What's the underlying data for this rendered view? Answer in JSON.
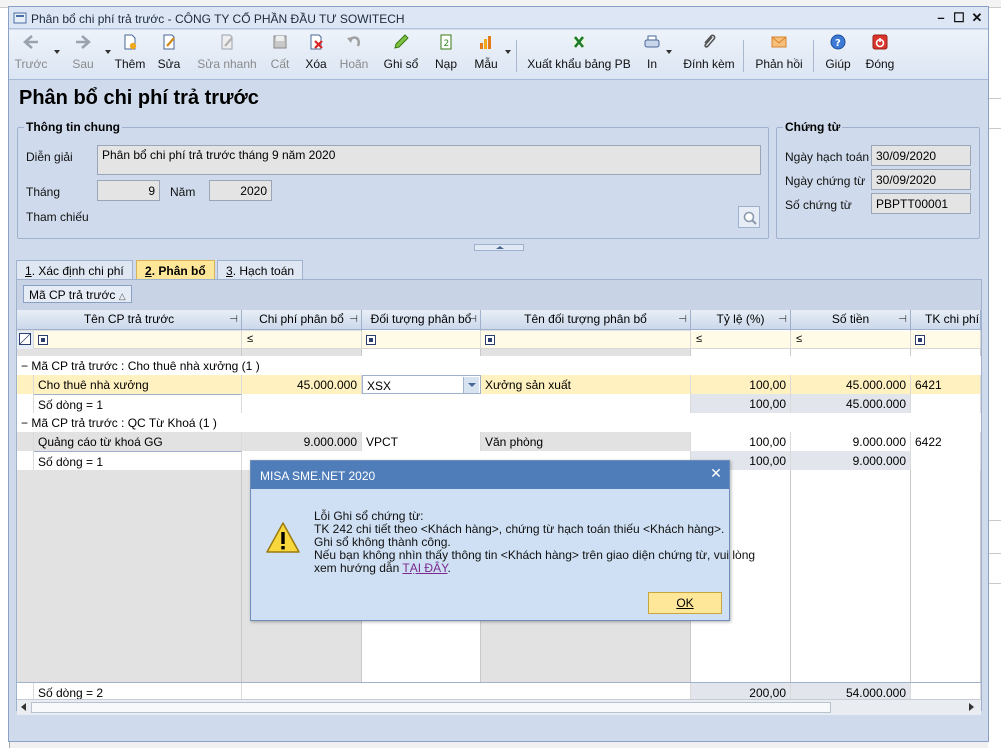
{
  "window": {
    "title": "Phân bổ chi phí trả trước - CÔNG TY CỔ PHẦN ĐẦU TƯ SOWITECH"
  },
  "toolbar": {
    "prev": "Trước",
    "next": "Sau",
    "add": "Thêm",
    "edit": "Sửa",
    "quick_edit": "Sửa nhanh",
    "save": "Cất",
    "delete": "Xóa",
    "undo": "Hoãn",
    "post": "Ghi sổ",
    "load": "Nạp",
    "template": "Mẫu",
    "export": "Xuất khẩu bảng PB",
    "print": "In",
    "attach": "Đính kèm",
    "feedback": "Phản hồi",
    "help": "Giúp",
    "close": "Đóng"
  },
  "page_title": "Phân bổ chi phí trả trước",
  "general": {
    "title": "Thông tin chung",
    "desc_label": "Diễn giải",
    "desc_value": "Phân bổ chi phí trả trước tháng 9 năm 2020",
    "month_label": "Tháng",
    "month_value": "9",
    "year_label": "Năm",
    "year_value": "2020",
    "ref_label": "Tham chiếu"
  },
  "voucher": {
    "title": "Chứng từ",
    "posting_date_label": "Ngày hạch toán",
    "posting_date": "30/09/2020",
    "voucher_date_label": "Ngày chứng từ",
    "voucher_date": "30/09/2020",
    "voucher_no_label": "Số chứng từ",
    "voucher_no": "PBPTT00001"
  },
  "tabs": [
    {
      "num": "1",
      "label": ". Xác định chi phí"
    },
    {
      "num": "2",
      "label": ". Phân bổ"
    },
    {
      "num": "3",
      "label": ". Hạch toán"
    }
  ],
  "group_chip": "Mã CP trả trước",
  "grid": {
    "headers": [
      "Tên CP trả trước",
      "Chi phí phân bổ",
      "Đối tượng phân bổ",
      "Tên đối tượng phân bổ",
      "Tỷ lệ (%)",
      "Số tiền",
      "TK chi phí"
    ],
    "filter_le": "≤",
    "groups": [
      {
        "label": "Mã CP trả trước : Cho thuê nhà xưởng (1 )",
        "row": {
          "name": "Cho thuê nhà xưởng",
          "cost": "45.000.000",
          "object": "XSX",
          "object_name": "Xưởng sản xuất",
          "rate": "100,00",
          "amount": "45.000.000",
          "account": "6421"
        },
        "sum": {
          "label": "Số dòng = 1",
          "rate": "100,00",
          "amount": "45.000.000"
        }
      },
      {
        "label": "Mã CP trả trước : QC Từ Khoá (1 )",
        "row": {
          "name": "Quảng cáo từ khoá GG",
          "cost": "9.000.000",
          "object": "VPCT",
          "object_name": "Văn phòng",
          "rate": "100,00",
          "amount": "9.000.000",
          "account": "6422"
        },
        "sum": {
          "label": "Số dòng = 1",
          "rate": "100,00",
          "amount": "9.000.000"
        }
      }
    ],
    "total": {
      "label": "Số dòng = 2",
      "rate": "200,00",
      "amount": "54.000.000"
    }
  },
  "dialog": {
    "title": "MISA SME.NET 2020",
    "line1": "Lỗi Ghi sổ chứng từ:",
    "line2": "TK 242 chi tiết theo <Khách hàng>, chứng từ hạch toán thiếu <Khách hàng>.",
    "line3": "Ghi sổ không thành công.",
    "line4": "Nếu bạn không nhìn thấy thông tin <Khách hàng> trên giao diện chứng từ, vui lòng",
    "line5_prefix": "xem hướng dẫn ",
    "line5_link": "TẠI ĐÂY",
    "line5_suffix": ".",
    "ok": "OK"
  }
}
